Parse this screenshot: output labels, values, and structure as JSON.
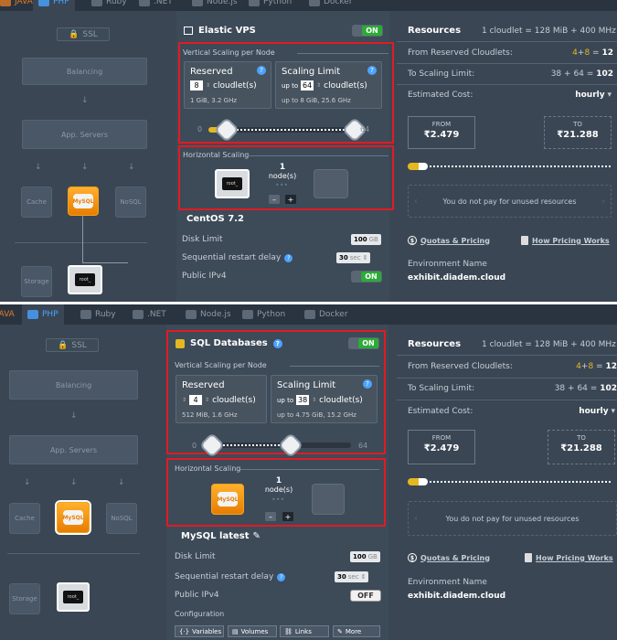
{
  "tabs": [
    "JAVA",
    "PHP",
    "Ruby",
    ".NET",
    "Node.js",
    "Python",
    "Docker"
  ],
  "topology": {
    "ssl": "SSL",
    "balancing": "Balancing",
    "app_servers": "App. Servers",
    "cache": "Cache",
    "nosql": "NoSQL",
    "storage": "Storage",
    "mysql_logo": "MySQL",
    "terminal_logo": "root_"
  },
  "top": {
    "title": "Elastic VPS",
    "toggle": "ON",
    "vertical_label": "Vertical Scaling per Node",
    "reserved": {
      "title": "Reserved",
      "value": "8",
      "unit": "cloudlet(s)",
      "detail": "1 GiB, 3.2 GHz"
    },
    "limit": {
      "title": "Scaling Limit",
      "upto": "up to",
      "value": "64",
      "unit": "cloudlet(s)",
      "detail": "up to 8 GiB, 25.6 GHz"
    },
    "slider": {
      "min": "0",
      "max": "64",
      "reserved_fraction": 0.125,
      "limit_fraction": 1.0
    },
    "horizontal_label": "Horizontal Scaling",
    "nodes": {
      "count": "1",
      "label": "node(s)",
      "minus": "–",
      "plus": "+"
    },
    "os": "CentOS 7.2",
    "disk_limit": {
      "label": "Disk Limit",
      "value": "100",
      "unit": "GB"
    },
    "restart_delay": {
      "label": "Sequential restart delay",
      "value": "30",
      "unit": "sec"
    },
    "ipv4": {
      "label": "Public IPv4",
      "state": "ON"
    }
  },
  "bottom": {
    "title": "SQL Databases",
    "toggle": "ON",
    "vertical_label": "Vertical Scaling per Node",
    "reserved": {
      "title": "Reserved",
      "value": "4",
      "unit": "cloudlet(s)",
      "detail": "512 MiB, 1.6 GHz"
    },
    "limit": {
      "title": "Scaling Limit",
      "upto": "up to",
      "value": "38",
      "unit": "cloudlet(s)",
      "detail": "up to 4.75 GiB, 15.2 GHz"
    },
    "slider": {
      "min": "0",
      "max": "64",
      "reserved_fraction": 0.0625,
      "limit_fraction": 0.59
    },
    "horizontal_label": "Horizontal Scaling",
    "nodes": {
      "count": "1",
      "label": "node(s)",
      "minus": "–",
      "plus": "+"
    },
    "os": "MySQL latest",
    "disk_limit": {
      "label": "Disk Limit",
      "value": "100",
      "unit": "GB"
    },
    "restart_delay": {
      "label": "Sequential restart delay",
      "value": "30",
      "unit": "sec"
    },
    "ipv4": {
      "label": "Public IPv4",
      "state": "OFF"
    },
    "configuration": {
      "label": "Configuration",
      "buttons": [
        "Variables",
        "Volumes",
        "Links",
        "More"
      ]
    }
  },
  "resources_top": {
    "title": "Resources",
    "info": "1 cloudlet = 128 MiB + 400 MHz",
    "from_reserved": {
      "label": "From Reserved Cloudlets:",
      "a": "4",
      "op": "+",
      "b": "8",
      "eq": "=",
      "total": "12"
    },
    "to_limit": {
      "label": "To Scaling Limit:",
      "a": "38",
      "op": "+",
      "b": "64",
      "eq": "=",
      "total": "102"
    },
    "est_cost": {
      "label": "Estimated Cost:",
      "period": "hourly"
    },
    "from_price": {
      "label": "FROM",
      "value": "₹2.479"
    },
    "to_price": {
      "label": "TO",
      "value": "₹21.288"
    },
    "unused_note": "You do not pay for unused resources",
    "quotas_link": "Quotas & Pricing",
    "pricing_link": "How Pricing Works",
    "env_label": "Environment Name",
    "env_value": "exhibit.diadem.cloud"
  },
  "resources_bottom": {
    "title": "Resources",
    "info": "1 cloudlet = 128 MiB + 400 MHz",
    "from_reserved": {
      "label": "From Reserved Cloudlets:",
      "a": "4",
      "op": "+",
      "b": "8",
      "eq": "=",
      "total": "12"
    },
    "to_limit": {
      "label": "To Scaling Limit:",
      "a": "38",
      "op": "+",
      "b": "64",
      "eq": "=",
      "total": "102"
    },
    "est_cost": {
      "label": "Estimated Cost:",
      "period": "hourly"
    },
    "from_price": {
      "label": "FROM",
      "value": "₹2.479"
    },
    "to_price": {
      "label": "TO",
      "value": "₹21.288"
    },
    "unused_note": "You do not pay for unused resources",
    "quotas_link": "Quotas & Pricing",
    "pricing_link": "How Pricing Works",
    "env_label": "Environment Name",
    "env_value": "exhibit.diadem.cloud"
  },
  "colors": {
    "accent": "#4ba3ff",
    "highlight": "#e11b22",
    "on": "#2cab38",
    "yellow": "#e5b821",
    "java": "#e07a24"
  }
}
